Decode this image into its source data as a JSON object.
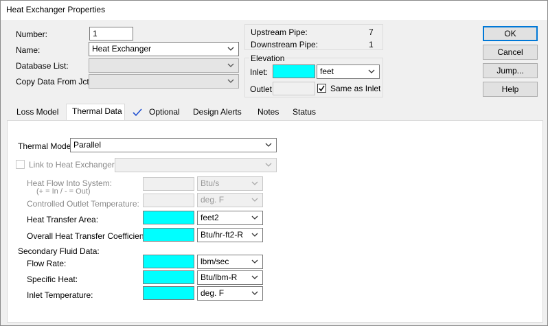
{
  "window": {
    "title": "Heat Exchanger Properties"
  },
  "header": {
    "number_label": "Number:",
    "number_value": "1",
    "name_label": "Name:",
    "name_value": "Heat Exchanger",
    "database_label": "Database List:",
    "database_value": "",
    "copy_label": "Copy Data From Jct...",
    "copy_value": ""
  },
  "pipes": {
    "upstream_label": "Upstream Pipe:",
    "upstream_value": "7",
    "downstream_label": "Downstream Pipe:",
    "downstream_value": "1"
  },
  "elevation": {
    "group_label": "Elevation",
    "inlet_label": "Inlet:",
    "inlet_value": "",
    "inlet_unit": "feet",
    "outlet_label": "Outlet:",
    "outlet_value": "",
    "same_as_inlet_label": "Same as Inlet",
    "same_as_inlet_checked": true
  },
  "buttons": {
    "ok": "OK",
    "cancel": "Cancel",
    "jump": "Jump...",
    "help": "Help"
  },
  "tabs": [
    {
      "label": "Loss Model",
      "active": false
    },
    {
      "label": "Thermal Data",
      "active": true
    },
    {
      "label": "Optional",
      "active": false,
      "checked": true
    },
    {
      "label": "Design Alerts",
      "active": false
    },
    {
      "label": "Notes",
      "active": false
    },
    {
      "label": "Status",
      "active": false
    }
  ],
  "thermal": {
    "model_label": "Thermal Model:",
    "model_value": "Parallel",
    "link_label": "Link to Heat Exchanger:",
    "link_value": "",
    "heat_flow_label": "Heat Flow Into System:",
    "heat_flow_sublabel": "(+ = In / - = Out)",
    "heat_flow_value": "",
    "heat_flow_unit": "Btu/s",
    "controlled_outlet_label": "Controlled Outlet Temperature:",
    "controlled_outlet_value": "",
    "controlled_outlet_unit": "deg. F",
    "area_label": "Heat Transfer Area:",
    "area_value": "",
    "area_unit": "feet2",
    "coefficient_label": "Overall Heat Transfer Coefficient:",
    "coefficient_value": "",
    "coefficient_unit": "Btu/hr-ft2-R",
    "secondary_label": "Secondary Fluid Data:",
    "flow_rate_label": "Flow Rate:",
    "flow_rate_value": "",
    "flow_rate_unit": "lbm/sec",
    "specific_heat_label": "Specific Heat:",
    "specific_heat_value": "",
    "specific_heat_unit": "Btu/lbm-R",
    "inlet_temp_label": "Inlet Temperature:",
    "inlet_temp_value": "",
    "inlet_temp_unit": "deg. F"
  },
  "colors": {
    "required_field": "#00ffff",
    "accent": "#0078d7"
  }
}
